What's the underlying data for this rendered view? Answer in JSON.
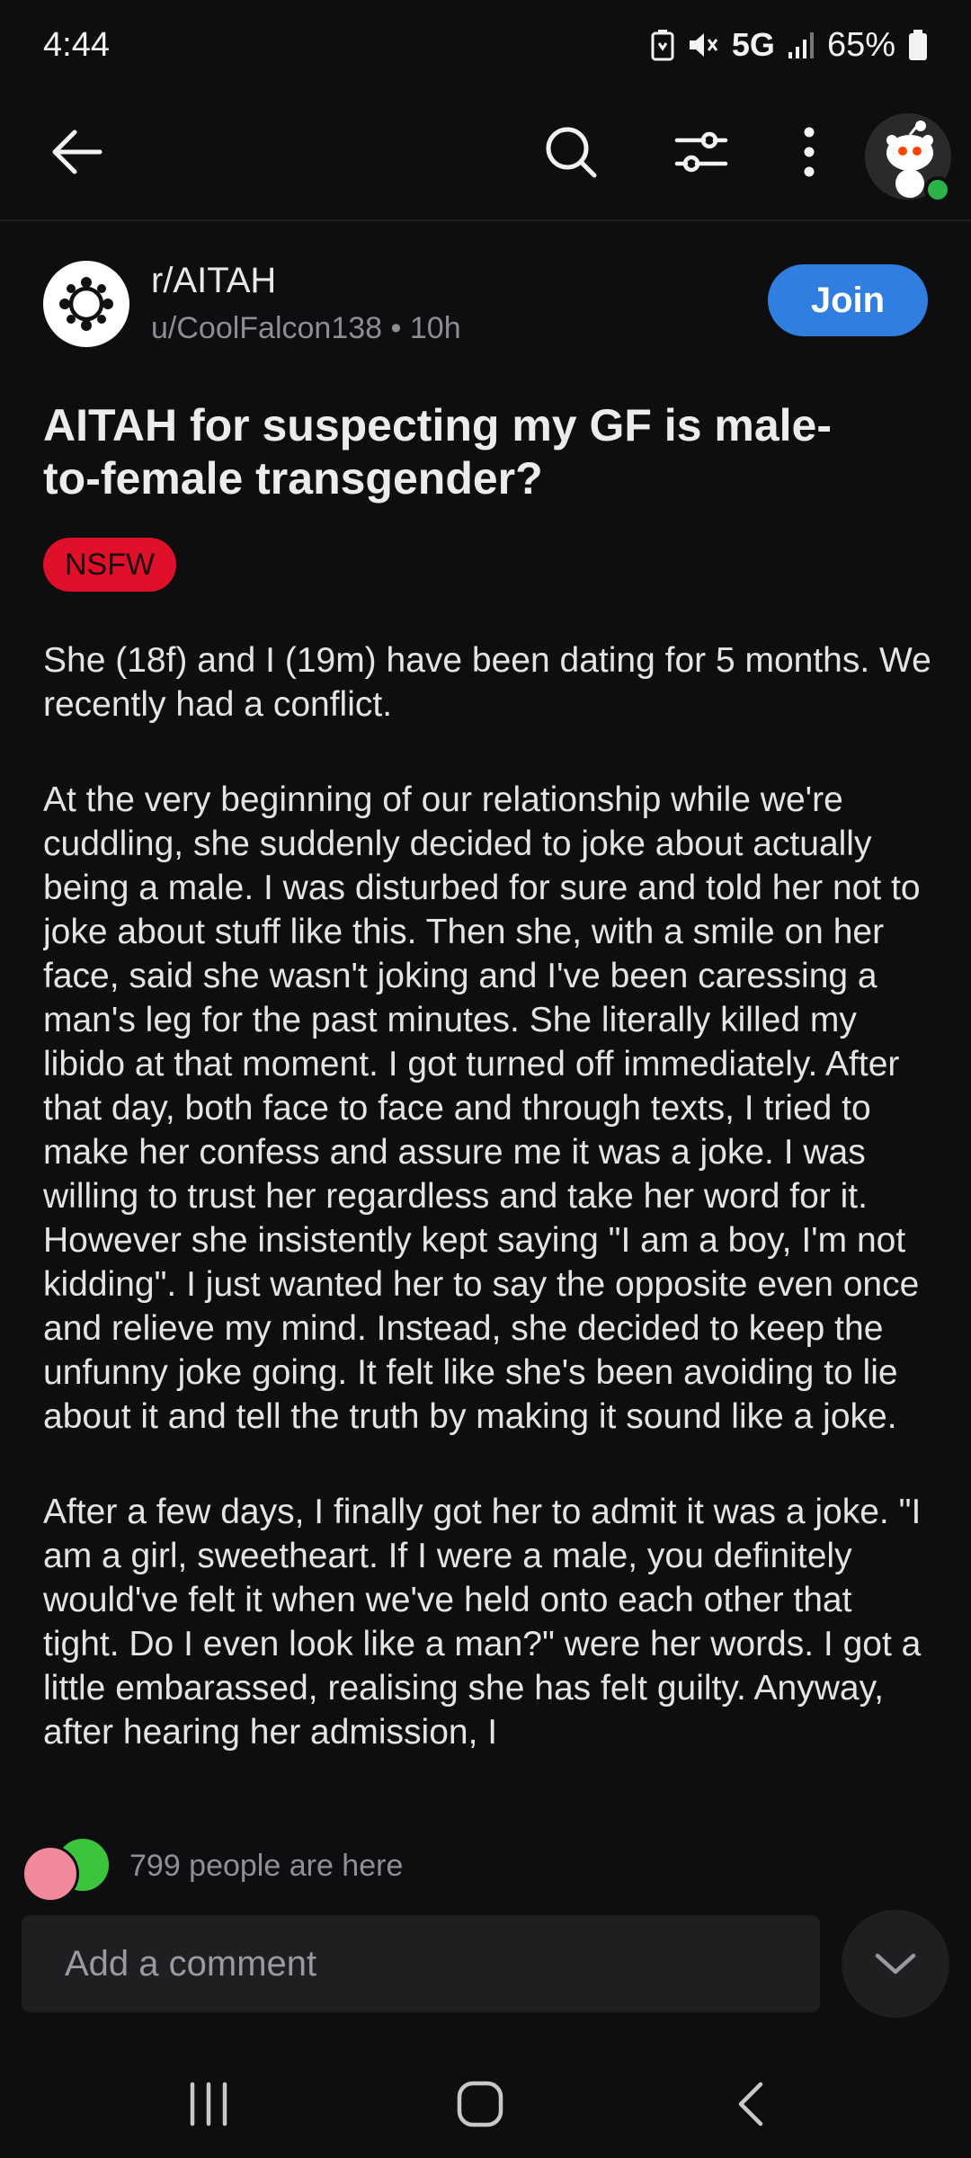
{
  "status_bar": {
    "time": "4:44",
    "network": "5G",
    "battery": "65%"
  },
  "toolbar": {
    "back_icon": "arrow-left-icon",
    "search_icon": "search-icon",
    "filter_icon": "sliders-icon",
    "more_icon": "more-vertical-icon"
  },
  "post": {
    "subreddit": "r/AITAH",
    "author": "u/CoolFalcon138",
    "age": "10h",
    "join_label": "Join",
    "title": "AITAH for suspecting my GF is male-to-female transgender?",
    "badge": "NSFW",
    "paragraphs": [
      "She (18f) and I (19m) have been dating for 5 months. We recently had a conflict.",
      "At the very beginning of our relationship while we're cuddling, she suddenly decided to joke about actually being a male. I was disturbed for sure and told her not to joke about stuff like this. Then she, with a smile on her face, said she wasn't joking and I've been caressing a man's leg for the past minutes. She literally killed my libido at that moment. I got turned off immediately. After that day, both face to face and through texts, I tried to make her confess and assure me it was a joke. I was willing to trust her regardless and take her word for it. However she insistently kept saying \"I am a boy, I'm not kidding\". I just wanted her to say the opposite even once and relieve my mind. Instead, she decided to keep the unfunny joke going. It felt like she's been avoiding to lie about it and tell the truth by making it sound like a joke.",
      "After a few days, I finally got her to admit it was a joke. \"I am a girl, sweetheart. If I were a male, you definitely would've felt it when we've held onto each other that tight. Do I even look like a man?\" were her words. I got a little embarassed, realising she has felt guilty. Anyway, after hearing her admission, I"
    ]
  },
  "presence": {
    "text": "799 people are here"
  },
  "comment": {
    "placeholder": "Add a comment"
  },
  "colors": {
    "background": "#0e0e10",
    "join": "#2f7ee0",
    "nsfw": "#e0102a",
    "online": "#2bb34a"
  }
}
